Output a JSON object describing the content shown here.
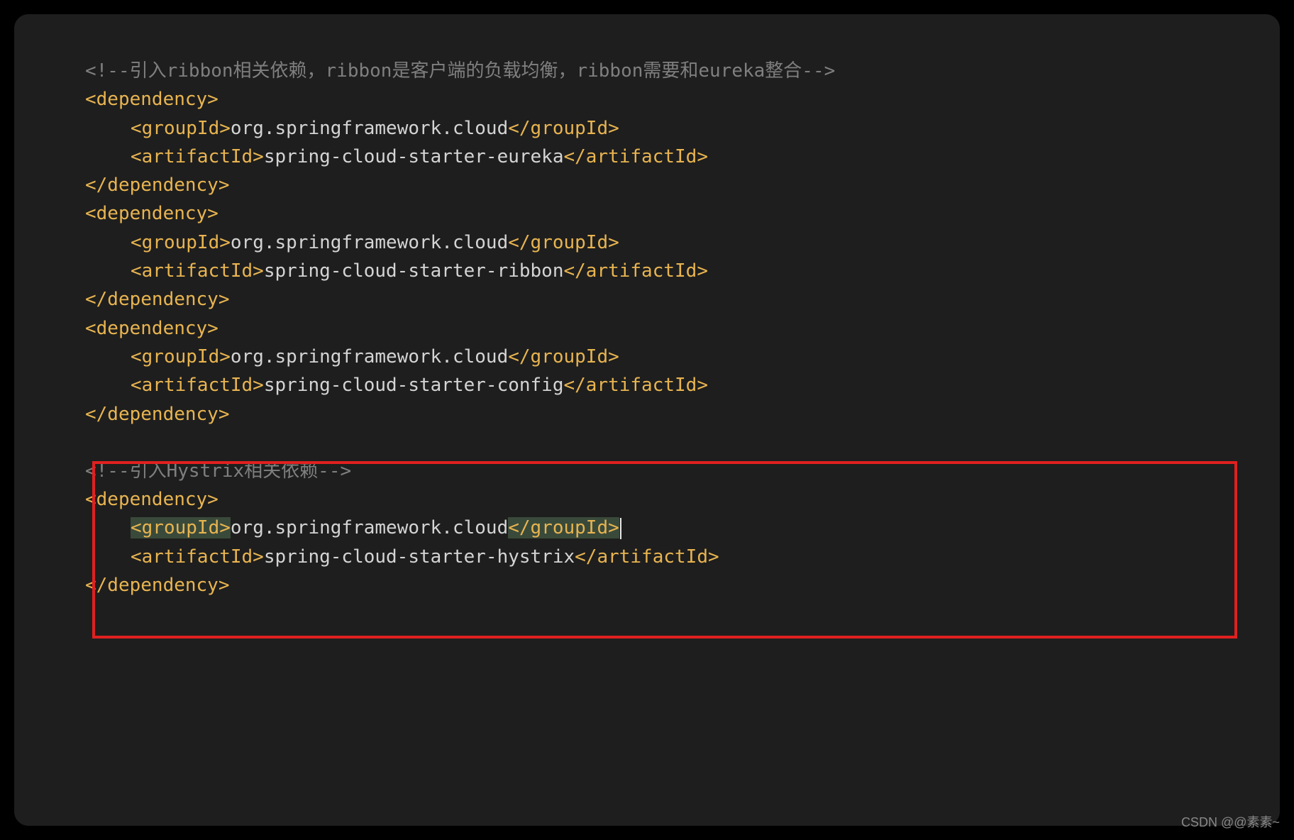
{
  "comment1": "<!--引入ribbon相关依赖，ribbon是客户端的负载均衡，ribbon需要和eureka整合-->",
  "comment2": "<!--引入Hystrix相关依赖-->",
  "tags": {
    "depOpen": "<dependency>",
    "depClose": "</dependency>",
    "groupOpen": "<groupId>",
    "groupClose": "</groupId>",
    "artifactOpen": "<artifactId>",
    "artifactClose": "</artifactId>"
  },
  "val": {
    "group": "org.springframework.cloud",
    "eureka": "spring-cloud-starter-eureka",
    "ribbon": "spring-cloud-starter-ribbon",
    "config": "spring-cloud-starter-config",
    "hystrix": "spring-cloud-starter-hystrix"
  },
  "watermark": "CSDN @@素素~"
}
